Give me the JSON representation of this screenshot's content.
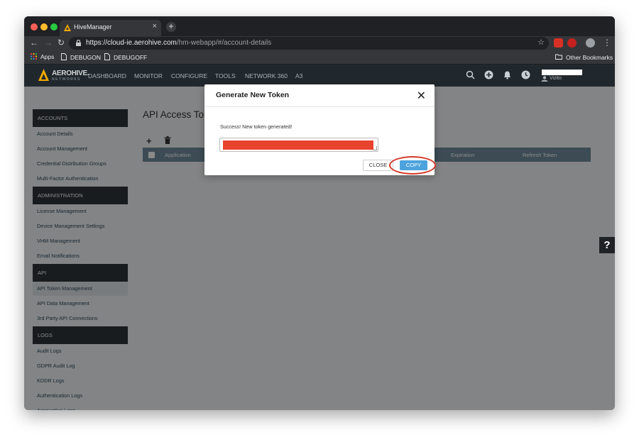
{
  "browser": {
    "tab_title": "HiveManager",
    "tab_close": "×",
    "new_tab": "+",
    "url_host": "https://cloud-ie.aerohive.com",
    "url_path": "/hm-webapp/#/account-details",
    "bookmarks": {
      "apps": "Apps",
      "debugon": "DEBUGON",
      "debugoff": "DEBUGOFF",
      "other": "Other Bookmarks"
    }
  },
  "app": {
    "logo_text": "AEROHIVE.",
    "logo_sub": "NETWORKS",
    "nav": [
      "DASHBOARD",
      "MONITOR",
      "CONFIGURE",
      "TOOLS",
      "NETWORK 360",
      "A3"
    ],
    "user_sub": "Vizito"
  },
  "sidebar": {
    "sections": [
      {
        "title": "ACCOUNTS",
        "items": [
          "Account Details",
          "Account Management",
          "Credential Distribution Groups",
          "Multi-Factor Authentication"
        ]
      },
      {
        "title": "ADMINISTRATION",
        "items": [
          "License Management",
          "Device Management Settings",
          "VHM Management",
          "Email Notifications"
        ]
      },
      {
        "title": "API",
        "items": [
          "API Token Management",
          "API Data Management",
          "3rd Party API Connections"
        ]
      },
      {
        "title": "LOGS",
        "items": [
          "Audit Logs",
          "GDPR Audit Log",
          "KDDR Logs",
          "Authentication Logs",
          "Accounting Logs"
        ]
      }
    ],
    "active_item": "API Token Management"
  },
  "main": {
    "title": "API Access Tok",
    "add_icon": "+",
    "table_columns": [
      "Application",
      "Expiration",
      "Refresh Token"
    ]
  },
  "modal": {
    "title": "Generate New Token",
    "close_icon": "✕",
    "message": "Success! New token generated!",
    "close_label": "CLOSE",
    "copy_label": "COPY"
  },
  "help": {
    "label": "?"
  },
  "colors": {
    "accent": "#4ea3de",
    "redaction": "#e8432e",
    "highlight": "#d53a2c",
    "table_header": "#6f8b9b"
  }
}
